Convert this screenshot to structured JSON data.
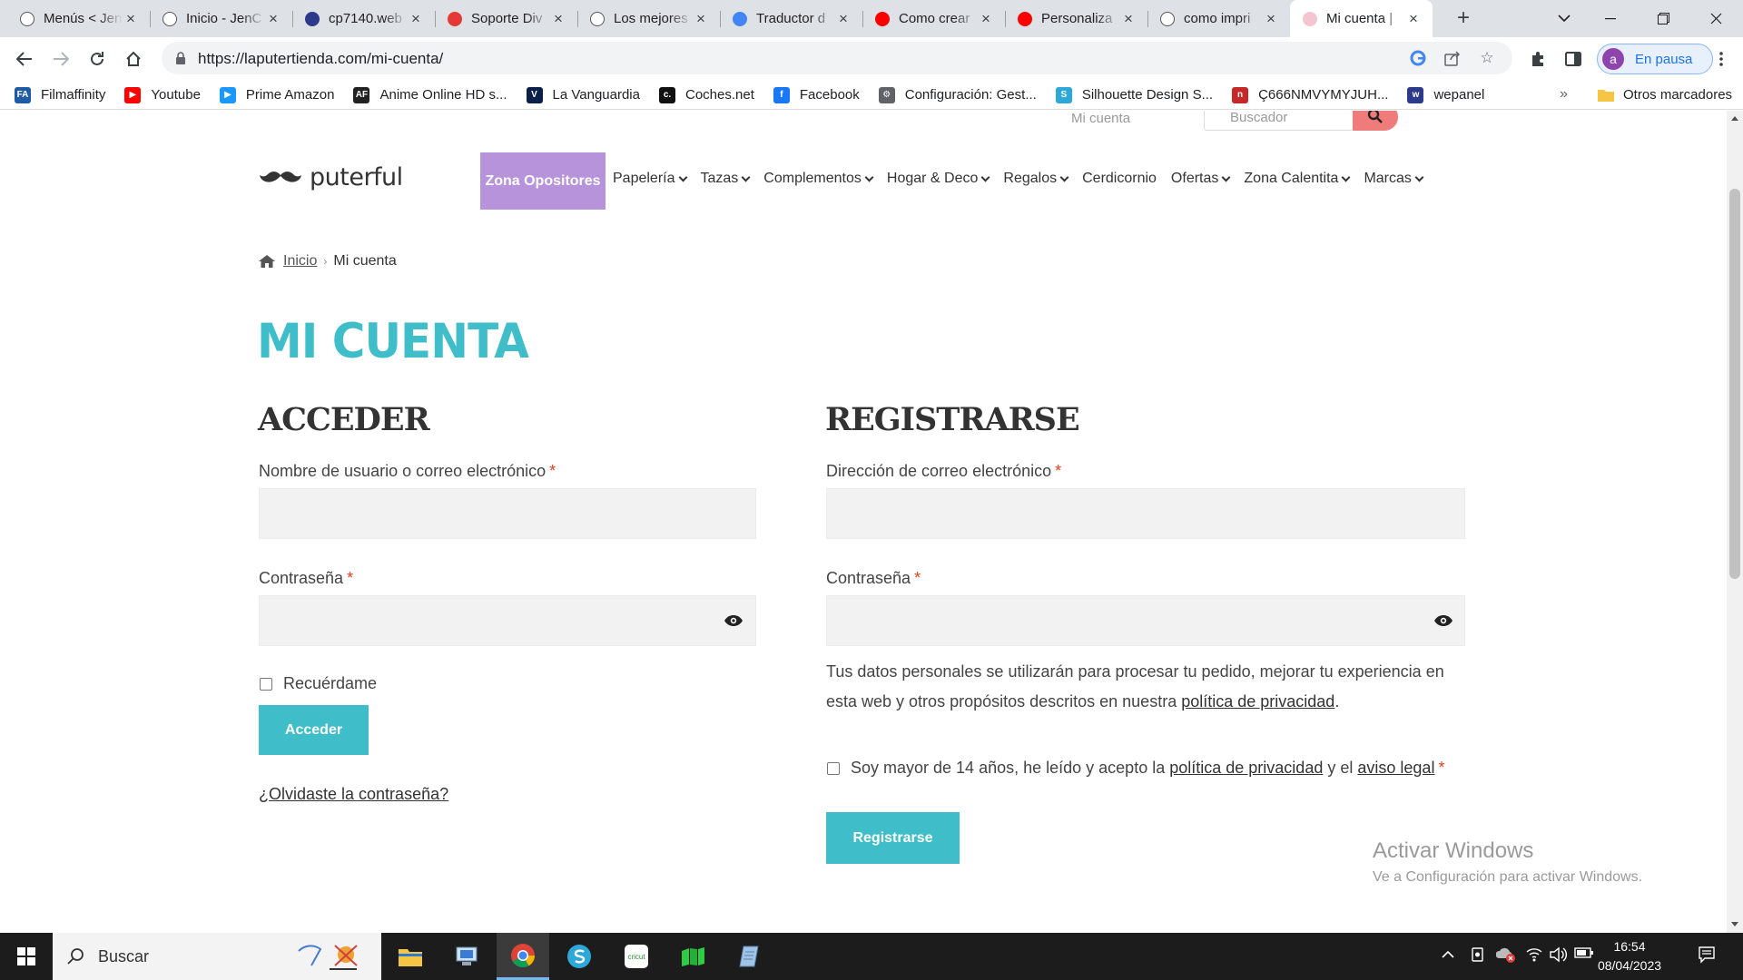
{
  "browser": {
    "tabs": [
      {
        "title": "Menús < Jen",
        "favicon": "tadp-logo",
        "color": "#ffffff"
      },
      {
        "title": "Inicio - JenC",
        "favicon": "tadp-logo",
        "color": "#ffffff"
      },
      {
        "title": "cp7140.web",
        "favicon": "webempresa-logo",
        "color": "#2d3a8c"
      },
      {
        "title": "Soporte Div",
        "favicon": "webempresa-red-logo",
        "color": "#e53935"
      },
      {
        "title": "Los mejores",
        "favicon": "gn-logo",
        "color": "#ffffff"
      },
      {
        "title": "Traductor d",
        "favicon": "translate-logo",
        "color": "#4285f4"
      },
      {
        "title": "Como crear",
        "favicon": "youtube-logo",
        "color": "#ff0000"
      },
      {
        "title": "Personaliza",
        "favicon": "youtube-logo",
        "color": "#ff0000"
      },
      {
        "title": "como impri",
        "favicon": "google-logo",
        "color": "#ffffff"
      },
      {
        "title": "Mi cuenta |",
        "favicon": "puterful-logo",
        "color": "#f3c5d0",
        "active": true
      }
    ],
    "url": "https://laputertienda.com/mi-cuenta/",
    "profile_label": "En pausa",
    "profile_initial": "a",
    "bookmarks": [
      {
        "label": "Filmaffinity",
        "icon": "filmaffinity-icon",
        "color": "#1f5aa6",
        "glyph": "FA"
      },
      {
        "label": "Youtube",
        "icon": "youtube-icon",
        "color": "#ff0000",
        "glyph": "▶"
      },
      {
        "label": "Prime Amazon",
        "icon": "prime-video-icon",
        "color": "#1a98ff",
        "glyph": "▶"
      },
      {
        "label": "Anime Online HD s...",
        "icon": "animeflv-icon",
        "color": "#222222",
        "glyph": "AF"
      },
      {
        "label": "La Vanguardia",
        "icon": "lavanguardia-icon",
        "color": "#0b1f4b",
        "glyph": "V"
      },
      {
        "label": "Coches.net",
        "icon": "cochesnet-icon",
        "color": "#111111",
        "glyph": "c."
      },
      {
        "label": "Facebook",
        "icon": "facebook-icon",
        "color": "#1877f2",
        "glyph": "f"
      },
      {
        "label": "Configuración: Gest...",
        "icon": "gear-icon",
        "color": "#5f6368",
        "glyph": "⚙"
      },
      {
        "label": "Silhouette Design S...",
        "icon": "silhouette-icon",
        "color": "#2ea8d8",
        "glyph": "S"
      },
      {
        "label": "Ç666NMVYMYJUH...",
        "icon": "red-bookmark-icon",
        "color": "#c62828",
        "glyph": "n"
      },
      {
        "label": "wepanel",
        "icon": "webempresa-icon",
        "color": "#2d3a8c",
        "glyph": "w"
      }
    ],
    "other_bookmarks": "Otros marcadores"
  },
  "site": {
    "top_link": "Mi cuenta",
    "search_placeholder": "Buscador",
    "logo_text": "puterful",
    "menu_highlight": "Zona Opositores",
    "menu": [
      {
        "label": "Papelería",
        "dropdown": true
      },
      {
        "label": "Tazas",
        "dropdown": true
      },
      {
        "label": "Complementos",
        "dropdown": true
      },
      {
        "label": "Hogar & Deco",
        "dropdown": true
      },
      {
        "label": "Regalos",
        "dropdown": true
      },
      {
        "label": "Cerdicornio",
        "dropdown": false
      },
      {
        "label": "Ofertas",
        "dropdown": true
      },
      {
        "label": "Zona Calentita",
        "dropdown": true
      },
      {
        "label": "Marcas",
        "dropdown": true
      }
    ],
    "breadcrumb": {
      "home": "Inicio",
      "current": "Mi cuenta"
    },
    "page_title": "MI CUENTA",
    "accent_color": "#3fbec9",
    "highlight_color": "#b693db"
  },
  "login": {
    "title": "ACCEDER",
    "username_label": "Nombre de usuario o correo electrónico",
    "username_value": "",
    "password_label": "Contraseña",
    "password_value": "",
    "remember_label": "Recuérdame",
    "submit_label": "Acceder",
    "forgot_label": "¿Olvidaste la contraseña?",
    "required_mark": "*"
  },
  "register": {
    "title": "REGISTRARSE",
    "email_label": "Dirección de correo electrónico",
    "email_value": "",
    "password_label": "Contraseña",
    "password_value": "",
    "privacy_text_before": "Tus datos personales se utilizarán para procesar tu pedido, mejorar tu experiencia en esta web y otros propósitos descritos en nuestra",
    "privacy_link": "política de privacidad",
    "privacy_text_after": ".",
    "consent_before": "Soy mayor de 14 años, he leído y acepto la",
    "consent_privacy_link": "política de privacidad",
    "consent_middle": "y el",
    "consent_legal_link": "aviso legal",
    "submit_label": "Registrarse",
    "required_mark": "*"
  },
  "watermark": {
    "title": "Activar Windows",
    "subtitle": "Ve a Configuración para activar Windows."
  },
  "taskbar": {
    "search_label": "Buscar",
    "time": "16:54",
    "date": "08/04/2023"
  }
}
